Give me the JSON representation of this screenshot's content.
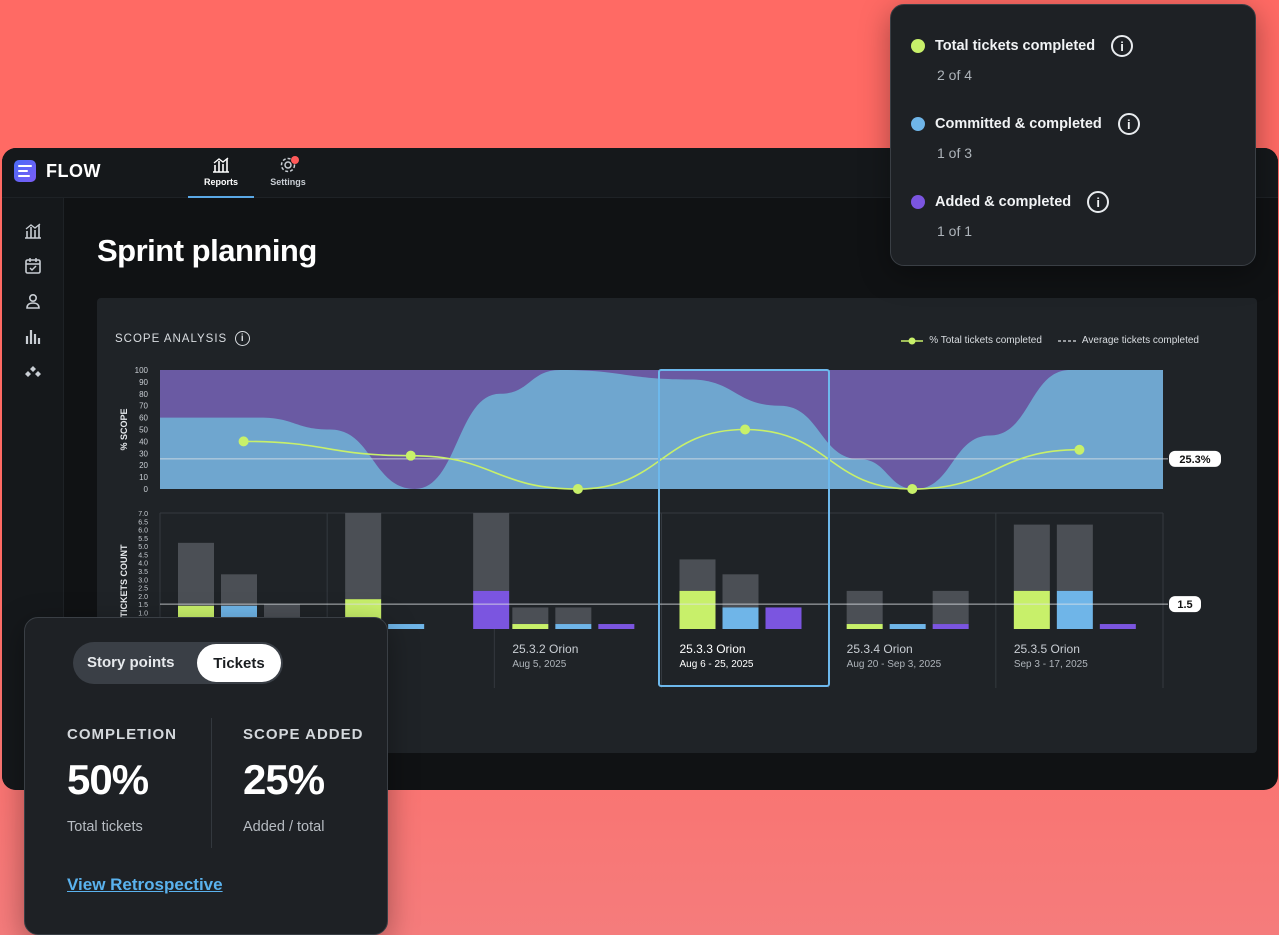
{
  "app": {
    "name": "FLOW"
  },
  "nav": {
    "tabs": [
      {
        "label": "Reports",
        "icon": "bar-chart-icon",
        "active": true
      },
      {
        "label": "Settings",
        "icon": "gear-icon",
        "badge": true
      }
    ]
  },
  "sidebar": {
    "icons": [
      "reports-icon",
      "calendar-icon",
      "person-icon",
      "bar-chart-icon",
      "diamond-cluster-icon"
    ]
  },
  "page": {
    "title": "Sprint planning"
  },
  "scope_analysis": {
    "title": "SCOPE ANALYSIS",
    "legend": {
      "series_line": "% Total tickets completed",
      "average_line": "Average tickets completed"
    },
    "scope_axis_label": "% SCOPE",
    "count_axis_label": "TICKETS COUNT",
    "scope_ref_label": "25.3%",
    "count_ref_label": "1.5",
    "iterations": [
      {
        "name": "",
        "dates": ""
      },
      {
        "name": "Orion",
        "dates": "2, 2025"
      },
      {
        "name": "25.3.2 Orion",
        "dates": "Aug 5, 2025"
      },
      {
        "name": "25.3.3 Orion",
        "dates": "Aug 6 - 25, 2025"
      },
      {
        "name": "25.3.4 Orion",
        "dates": "Aug 20 - Sep 3, 2025"
      },
      {
        "name": "25.3.5 Orion",
        "dates": "Sep 3 - 17, 2025"
      }
    ]
  },
  "chart_data": [
    {
      "type": "area",
      "ylabel": "% SCOPE",
      "ylim": [
        0,
        100
      ],
      "yticks": [
        0,
        10,
        20,
        30,
        40,
        50,
        60,
        70,
        80,
        90,
        100
      ],
      "categories": [
        "",
        "Orion",
        "25.3.2 Orion",
        "25.3.3 Orion",
        "25.3.4 Orion",
        "25.3.5 Orion"
      ],
      "series": [
        {
          "name": "% Total tickets completed",
          "values": [
            40,
            28,
            0,
            50,
            0,
            33
          ]
        }
      ],
      "reference_line": 25.3,
      "colors": {
        "line": "#c8f06a",
        "committed_area": "#6fa6cf",
        "added_area": "#6a5aa3"
      }
    },
    {
      "type": "bar",
      "ylabel": "TICKETS COUNT",
      "ylim": [
        0,
        7
      ],
      "yticks": [
        0,
        0.5,
        1.0,
        1.5,
        2.0,
        2.5,
        3.0,
        3.5,
        4.0,
        4.5,
        5.0,
        5.5,
        6.0,
        6.5,
        7.0
      ],
      "categories": [
        "",
        "Orion",
        "25.3.2 Orion",
        "25.3.3 Orion",
        "25.3.4 Orion",
        "25.3.5 Orion"
      ],
      "bar_groups": [
        [
          {
            "total": 5.2,
            "completed": 1.4,
            "color": "#c8f06a"
          },
          {
            "total": 3.3,
            "completed": 1.4,
            "color": "#6fb5e8"
          },
          {
            "total": 1.5,
            "completed": 0,
            "color": "#7b55e0"
          }
        ],
        [
          {
            "total": 7.0,
            "completed": 1.8,
            "color": "#c8f06a"
          },
          {
            "total": 0.3,
            "completed": 0.3,
            "color": "#6fb5e8"
          },
          {
            "total": 7.0,
            "completed": 2.3,
            "color": "#7b55e0"
          }
        ],
        [
          {
            "total": 1.3,
            "completed": 0.3,
            "color": "#c8f06a"
          },
          {
            "total": 1.3,
            "completed": 0.3,
            "color": "#6fb5e8"
          },
          {
            "total": 0.3,
            "completed": 0.3,
            "color": "#7b55e0"
          }
        ],
        [
          {
            "total": 4.2,
            "completed": 2.3,
            "color": "#c8f06a"
          },
          {
            "total": 3.3,
            "completed": 1.3,
            "color": "#6fb5e8"
          },
          {
            "total": 1.3,
            "completed": 1.3,
            "color": "#7b55e0"
          }
        ],
        [
          {
            "total": 2.3,
            "completed": 0.3,
            "color": "#c8f06a"
          },
          {
            "total": 0.3,
            "completed": 0.3,
            "color": "#6fb5e8"
          },
          {
            "total": 2.3,
            "completed": 0.3,
            "color": "#7b55e0"
          }
        ],
        [
          {
            "total": 6.3,
            "completed": 2.3,
            "color": "#c8f06a"
          },
          {
            "total": 6.3,
            "completed": 2.3,
            "color": "#6fb5e8"
          },
          {
            "total": 0.3,
            "completed": 0.3,
            "color": "#7b55e0"
          }
        ]
      ],
      "reference_line": 1.5
    }
  ],
  "tooltip": {
    "rows": [
      {
        "label": "Total tickets completed",
        "value": "2 of 4",
        "color": "#c8f06a"
      },
      {
        "label": "Committed & completed",
        "value": "1 of 3",
        "color": "#6fb5e8"
      },
      {
        "label": "Added & completed",
        "value": "1 of 1",
        "color": "#7b55e0"
      }
    ]
  },
  "summary": {
    "toggle": {
      "options": [
        "Story points",
        "Tickets"
      ],
      "selected": "Tickets"
    },
    "completion": {
      "label": "COMPLETION",
      "value": "50%",
      "sub": "Total tickets"
    },
    "scope_added": {
      "label": "SCOPE ADDED",
      "value": "25%",
      "sub": "Added / total"
    },
    "link": "View Retrospective"
  }
}
